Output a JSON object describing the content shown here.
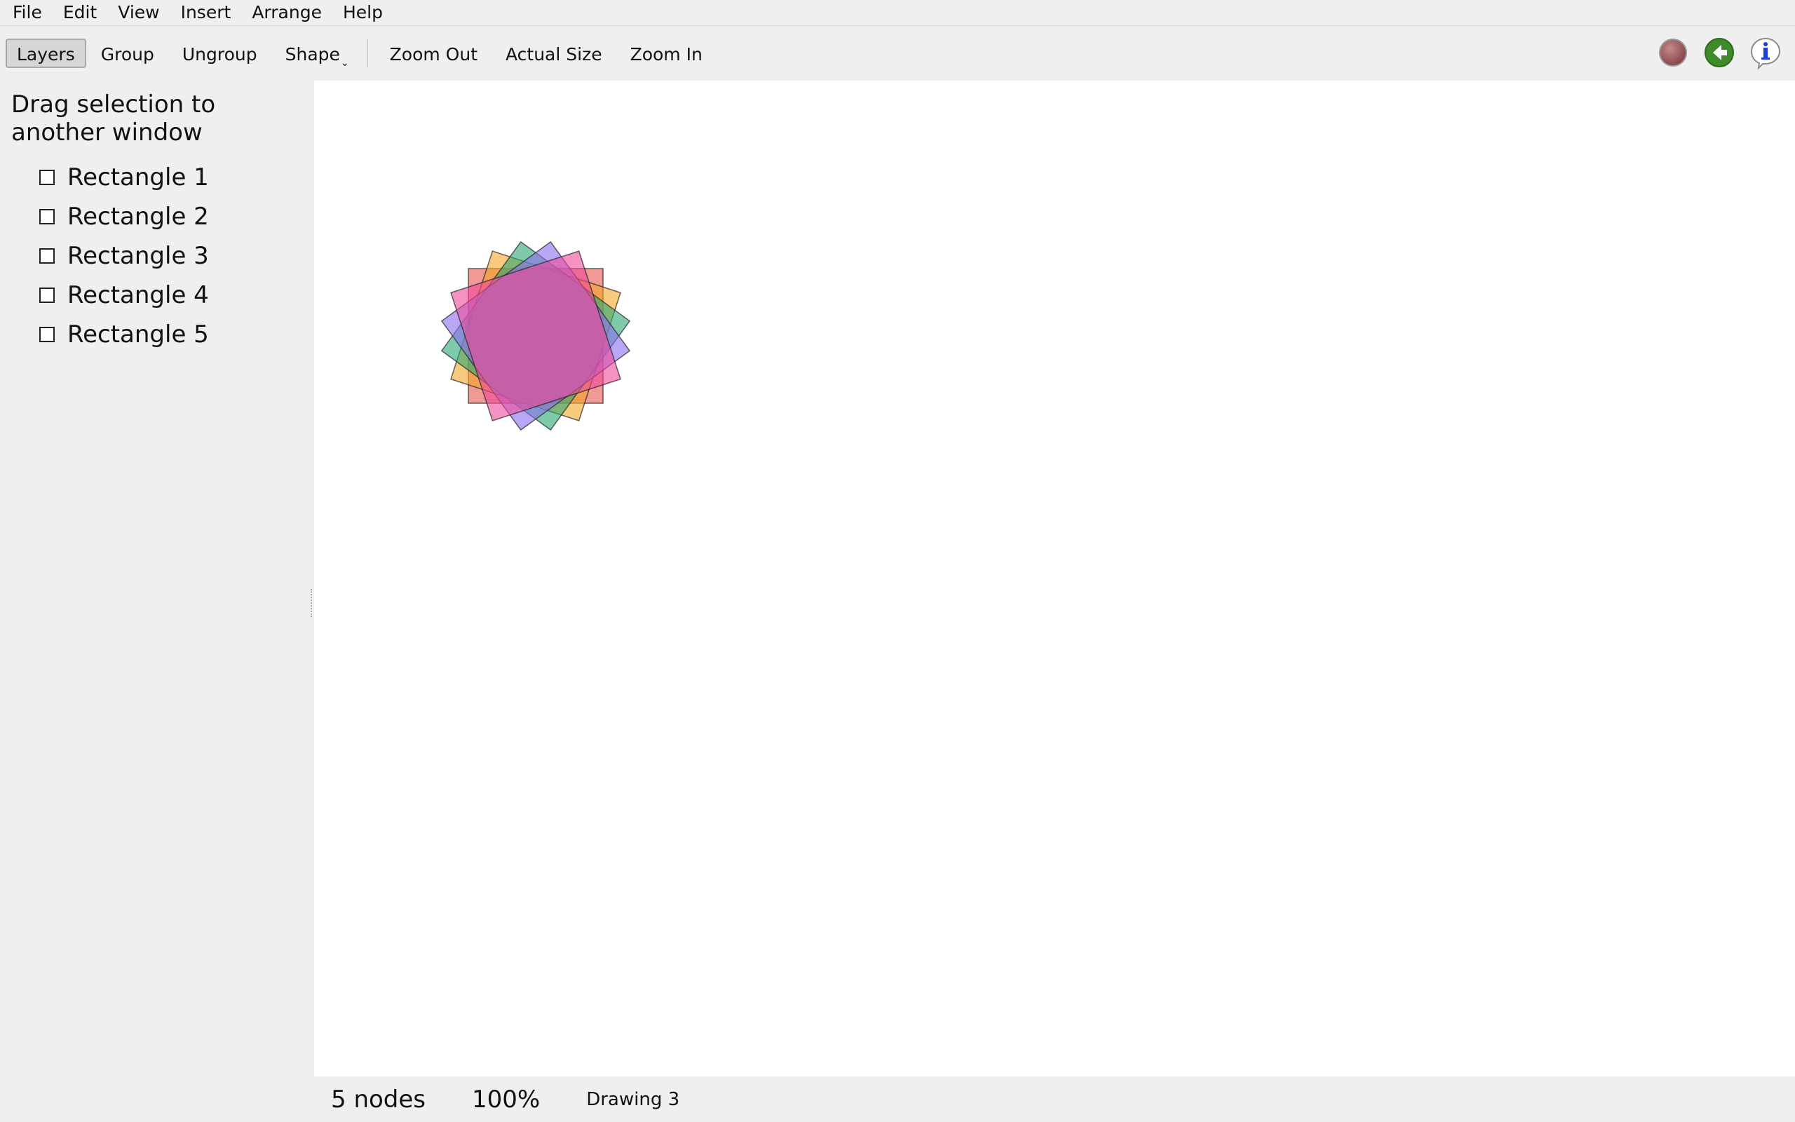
{
  "menu": [
    "File",
    "Edit",
    "View",
    "Insert",
    "Arrange",
    "Help"
  ],
  "toolbar": {
    "layers": "Layers",
    "group": "Group",
    "ungroup": "Ungroup",
    "shape": "Shape",
    "zoom_out": "Zoom Out",
    "actual_size": "Actual Size",
    "zoom_in": "Zoom In"
  },
  "toolbar_icons": [
    "record-icon",
    "back-arrow-icon",
    "info-icon"
  ],
  "sidebar": {
    "hint": "Drag selection to another window",
    "layers": [
      {
        "label": "Rectangle 1",
        "checked": false
      },
      {
        "label": "Rectangle 2",
        "checked": false
      },
      {
        "label": "Rectangle 3",
        "checked": false
      },
      {
        "label": "Rectangle 4",
        "checked": false
      },
      {
        "label": "Rectangle 5",
        "checked": false
      }
    ]
  },
  "canvas": {
    "shapes": [
      {
        "name": "Rectangle 1",
        "color": "#e8564f",
        "rotation_deg": 0
      },
      {
        "name": "Rectangle 2",
        "color": "#f4a628",
        "rotation_deg": 18
      },
      {
        "name": "Rectangle 3",
        "color": "#2aa672",
        "rotation_deg": 36
      },
      {
        "name": "Rectangle 4",
        "color": "#8a6cf0",
        "rotation_deg": 54
      },
      {
        "name": "Rectangle 5",
        "color": "#f0479b",
        "rotation_deg": 72
      }
    ]
  },
  "status": {
    "nodes": "5 nodes",
    "zoom": "100%",
    "document": "Drawing 3"
  }
}
